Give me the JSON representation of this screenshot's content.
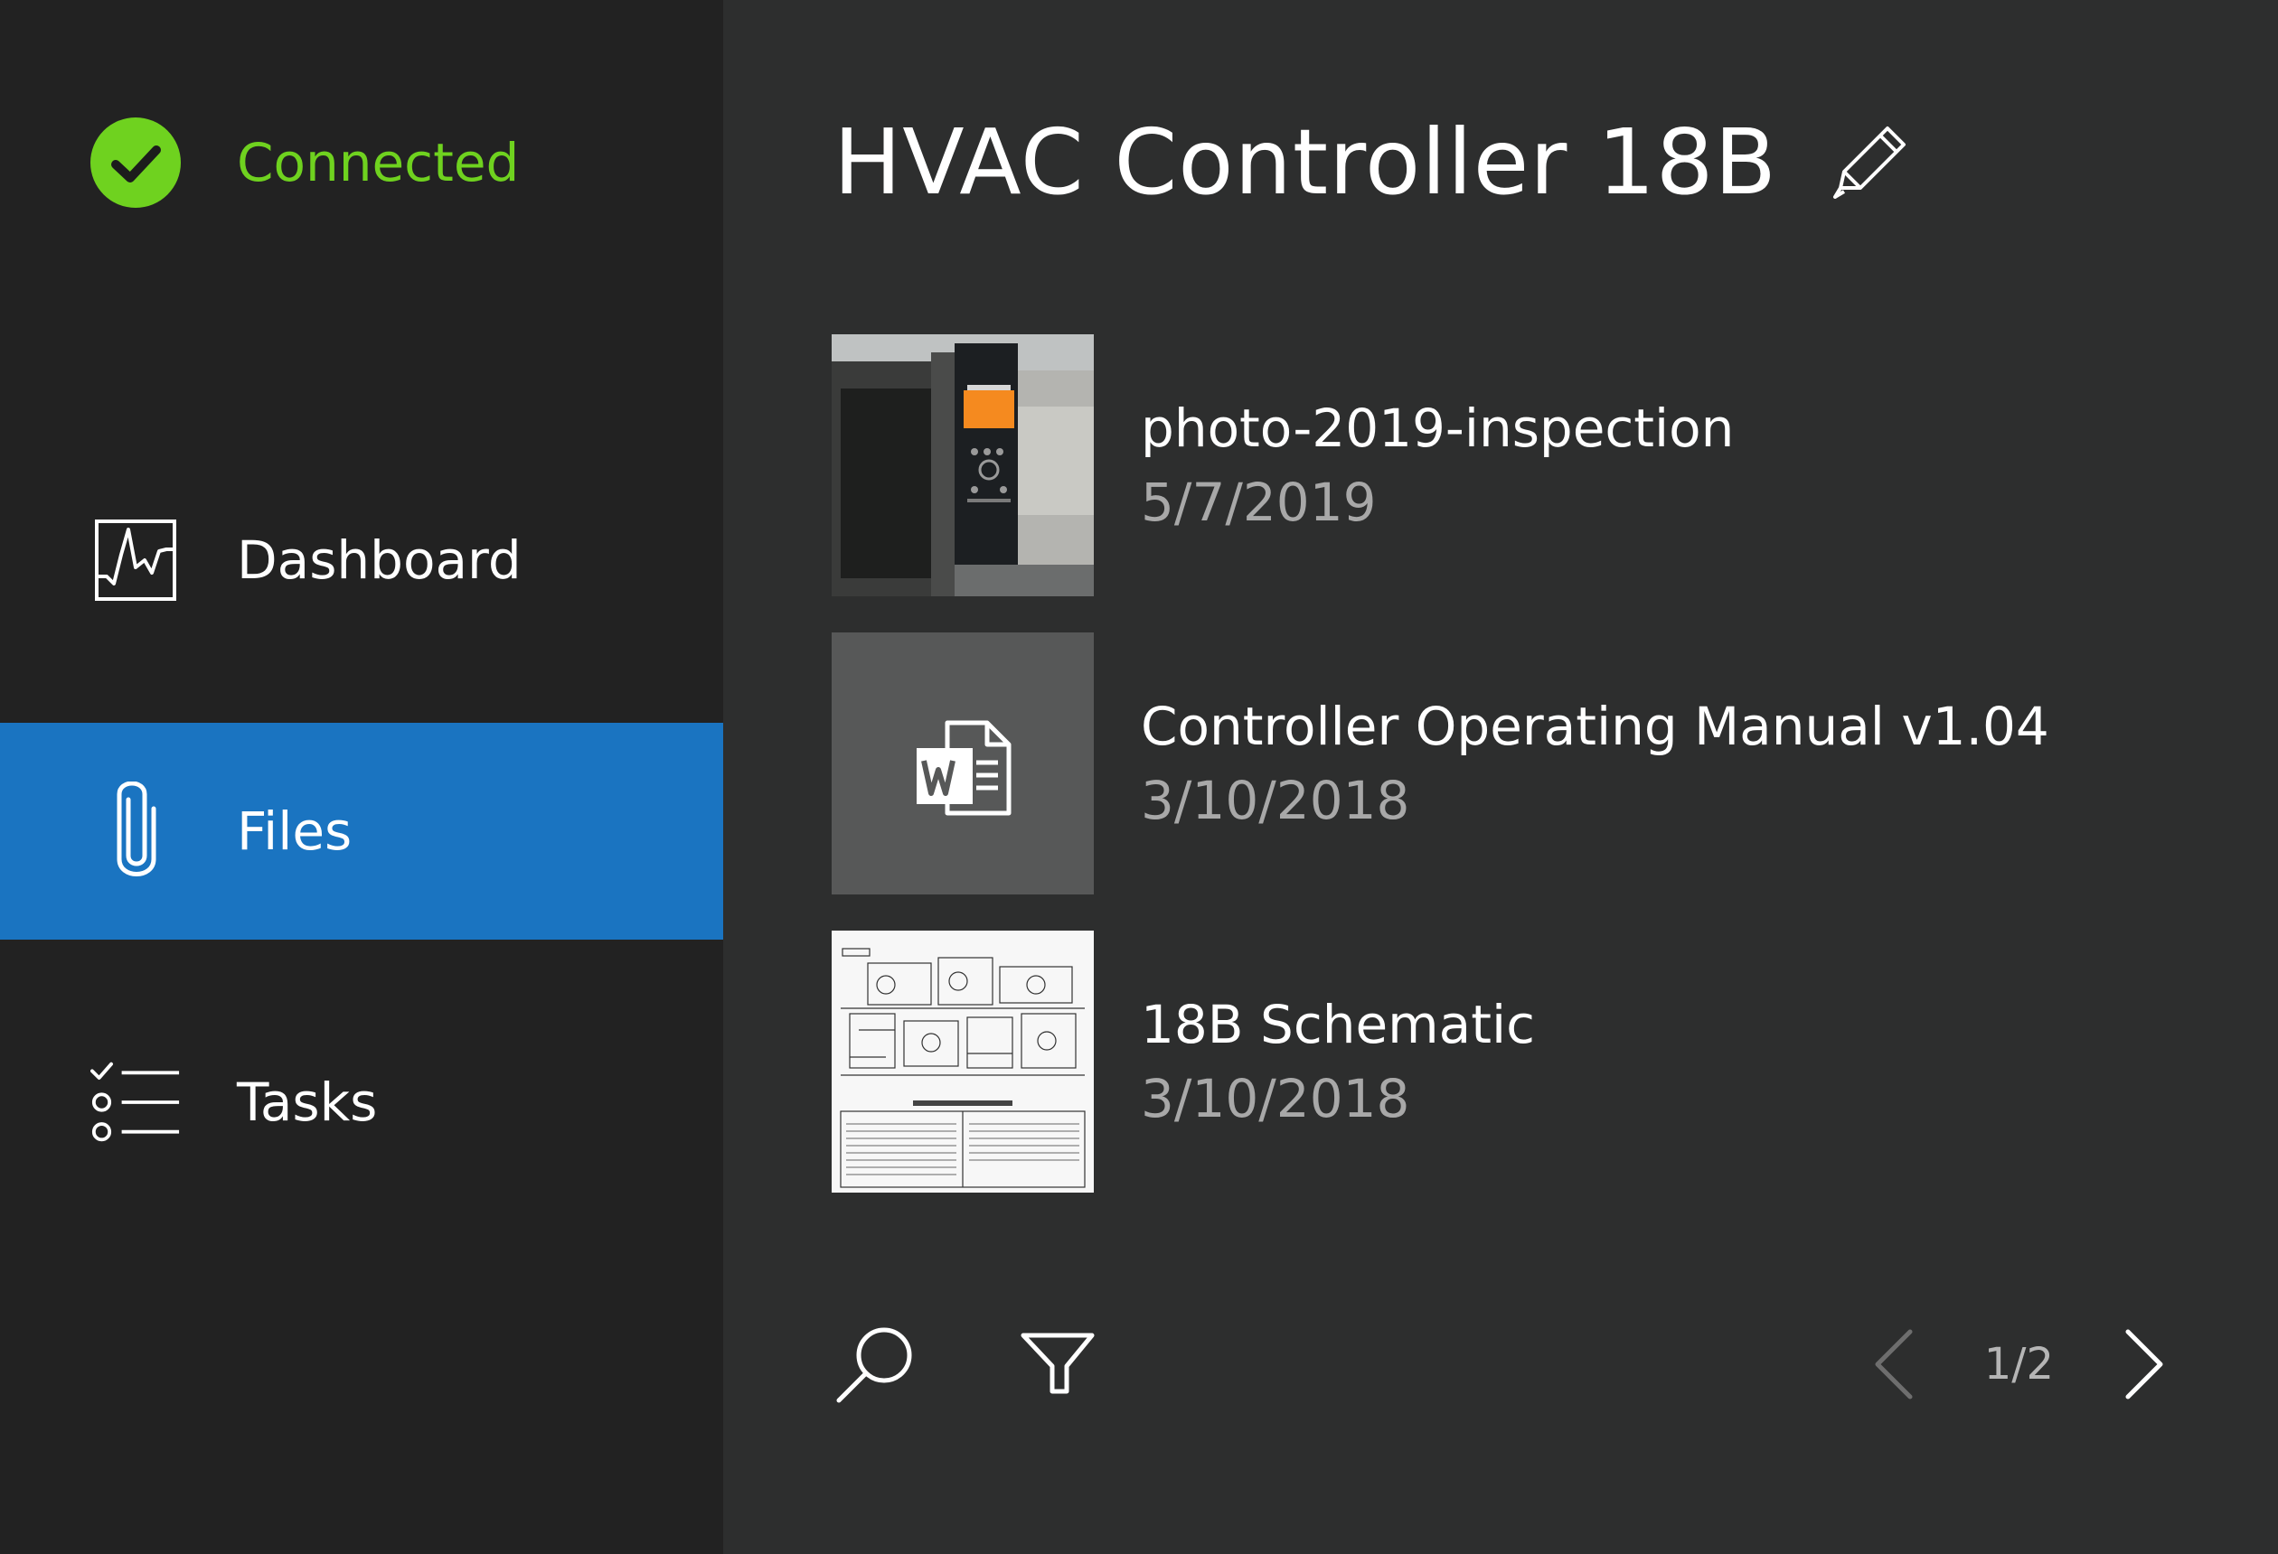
{
  "sidebar": {
    "status": {
      "label": "Connected",
      "icon": "check-circle-icon",
      "color": "#6fd21f"
    },
    "items": [
      {
        "label": "Dashboard",
        "icon": "dashboard-chart-icon",
        "active": false
      },
      {
        "label": "Files",
        "icon": "paperclip-icon",
        "active": true
      },
      {
        "label": "Tasks",
        "icon": "checklist-icon",
        "active": false
      }
    ],
    "accent_color": "#1a74c1"
  },
  "main": {
    "title": "HVAC Controller 18B",
    "edit_icon": "pencil-icon",
    "files": [
      {
        "name": "photo-2019-inspection",
        "date": "5/7/2019",
        "thumbnail": "photo-thumbnail"
      },
      {
        "name": "Controller Operating Manual v1.04",
        "date": "3/10/2018",
        "thumbnail": "word-document-icon"
      },
      {
        "name": "18B Schematic",
        "date": "3/10/2018",
        "thumbnail": "schematic-thumbnail"
      }
    ],
    "toolbar": {
      "search_icon": "search-icon",
      "filter_icon": "filter-icon"
    },
    "pager": {
      "page": "1/2",
      "prev_icon": "chevron-left-icon",
      "next_icon": "chevron-right-icon"
    }
  }
}
